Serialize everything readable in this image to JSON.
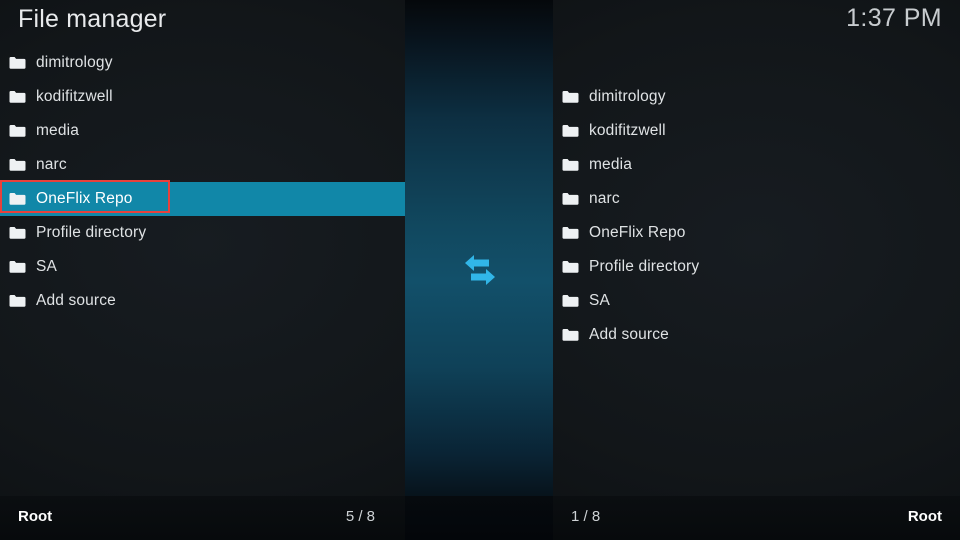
{
  "header": {
    "title": "File manager",
    "clock": "1:37 PM"
  },
  "panels": {
    "left": {
      "items": [
        {
          "label": "dimitrology",
          "icon": "folder-icon",
          "selected": false
        },
        {
          "label": "kodifitzwell",
          "icon": "folder-icon",
          "selected": false
        },
        {
          "label": "media",
          "icon": "folder-icon",
          "selected": false
        },
        {
          "label": "narc",
          "icon": "folder-icon",
          "selected": false
        },
        {
          "label": "OneFlix Repo",
          "icon": "folder-icon",
          "selected": true
        },
        {
          "label": "Profile directory",
          "icon": "folder-icon",
          "selected": false
        },
        {
          "label": "SA",
          "icon": "folder-icon",
          "selected": false
        },
        {
          "label": "Add source",
          "icon": "folder-icon",
          "selected": false
        }
      ],
      "footer_path": "Root",
      "footer_count": "5 / 8"
    },
    "right": {
      "items": [
        {
          "label": "dimitrology",
          "icon": "folder-icon",
          "selected": false
        },
        {
          "label": "kodifitzwell",
          "icon": "folder-icon",
          "selected": false
        },
        {
          "label": "media",
          "icon": "folder-icon",
          "selected": false
        },
        {
          "label": "narc",
          "icon": "folder-icon",
          "selected": false
        },
        {
          "label": "OneFlix Repo",
          "icon": "folder-icon",
          "selected": false
        },
        {
          "label": "Profile directory",
          "icon": "folder-icon",
          "selected": false
        },
        {
          "label": "SA",
          "icon": "folder-icon",
          "selected": false
        },
        {
          "label": "Add source",
          "icon": "folder-icon",
          "selected": false
        }
      ],
      "footer_path": "Root",
      "footer_count": "1 / 8"
    }
  },
  "center": {
    "swap_icon": "swap-panes-icon"
  },
  "annotation": {
    "selection_marker_color": "#e8413c",
    "target_label": "OneFlix Repo"
  },
  "colors": {
    "background": "#14181c",
    "selection": "#1187a8",
    "accent_cyan": "#31b6e8",
    "text": "#dfe2e4",
    "annotation_red": "#e8413c"
  }
}
